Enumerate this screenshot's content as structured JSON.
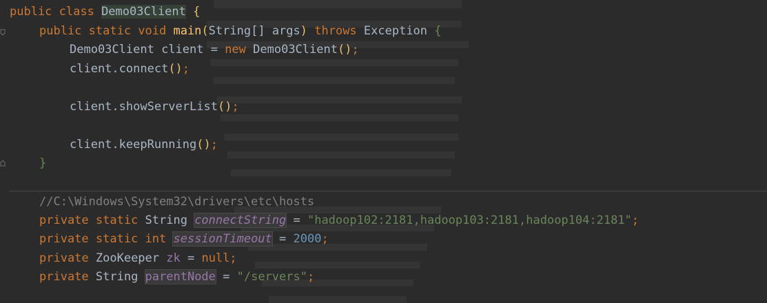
{
  "code": {
    "line1": {
      "kw": "public class ",
      "name": "Demo03Client",
      "sp": " ",
      "brace": "{"
    },
    "line2": {
      "kw1": "public static void ",
      "fn": "main",
      "p1": "(",
      "type": "String",
      "arr": "[] ",
      "arg": "args",
      "p2": ") ",
      "kw2": "throws ",
      "exc": "Exception",
      "sp": " ",
      "brace": "{"
    },
    "line3": {
      "type": "Demo03Client",
      "var": " client = ",
      "kw": "new ",
      "ctor": "Demo03Client",
      "call": "()",
      "semi": ";"
    },
    "line4": {
      "obj": "client.",
      "method": "connect",
      "call": "()",
      "semi": ";"
    },
    "line5": {
      "obj": "client.",
      "method": "showServerList",
      "call": "()",
      "semi": ";"
    },
    "line6": {
      "obj": "client.",
      "method": "keepRunning",
      "call": "()",
      "semi": ";"
    },
    "line7": {
      "brace": "}"
    },
    "line8": {
      "comment": "//C:\\Windows\\System32\\drivers\\etc\\hosts"
    },
    "line9": {
      "kw": "private static ",
      "type": "String ",
      "field": "connectString",
      "eq": " = ",
      "str": "\"hadoop102:2181,hadoop103:2181,hadoop104:2181\"",
      "semi": ";"
    },
    "line10": {
      "kw": "private static ",
      "type": "int ",
      "field": "sessionTimeout",
      "eq": " = ",
      "num": "2000",
      "semi": ";"
    },
    "line11": {
      "kw": "private ",
      "type": "ZooKeeper ",
      "field": "zk",
      "eq": " = ",
      "null": "null",
      "semi": ";"
    },
    "line12": {
      "kw": "private ",
      "type": "String ",
      "field": "parentNode",
      "eq": " = ",
      "str": "\"/servers\"",
      "semi": ";"
    }
  },
  "colors": {
    "background": "#2b2b2b",
    "keyword": "#cc7832",
    "function": "#ffc66d",
    "string": "#6a8759",
    "number": "#6897bb",
    "comment": "#808080",
    "field": "#9876aa",
    "plain": "#a9b7c6"
  }
}
